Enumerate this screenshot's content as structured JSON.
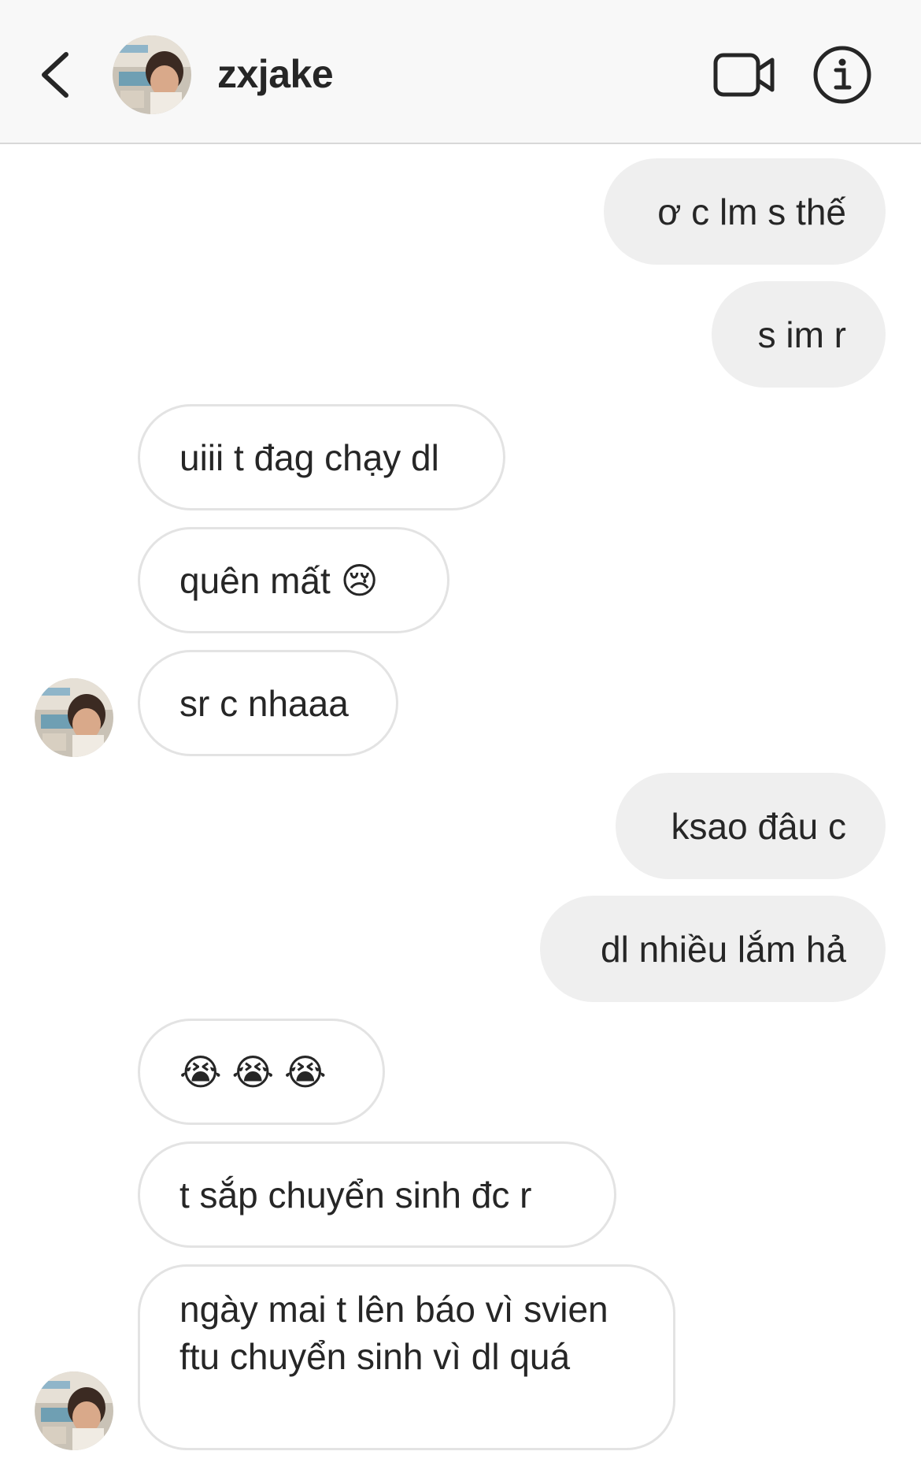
{
  "header": {
    "username": "zxjake",
    "icons": {
      "back": "chevron-left-icon",
      "video": "video-camera-icon",
      "info": "info-icon"
    }
  },
  "messages": [
    {
      "from": "me",
      "text": "ơ c lm s thế"
    },
    {
      "from": "me",
      "text": "s im r"
    },
    {
      "from": "them",
      "text": "uiii t đag chạy dl"
    },
    {
      "from": "them",
      "text": "quên mất 😢"
    },
    {
      "from": "them",
      "text": "sr c nhaaa"
    },
    {
      "from": "me",
      "text": "ksao đâu c"
    },
    {
      "from": "me",
      "text": "dl nhiều lắm hả"
    },
    {
      "from": "them",
      "text": "😭 😭 😭"
    },
    {
      "from": "them",
      "text": "t sắp chuyển sinh đc r"
    },
    {
      "from": "them",
      "text": "ngày mai t lên báo vì svien ftu chuyển sinh vì dl quá"
    }
  ],
  "colors": {
    "sent_bubble": "#efefef",
    "received_border": "#e3e3e3",
    "header_bg": "#f8f8f8",
    "text": "#262626"
  }
}
